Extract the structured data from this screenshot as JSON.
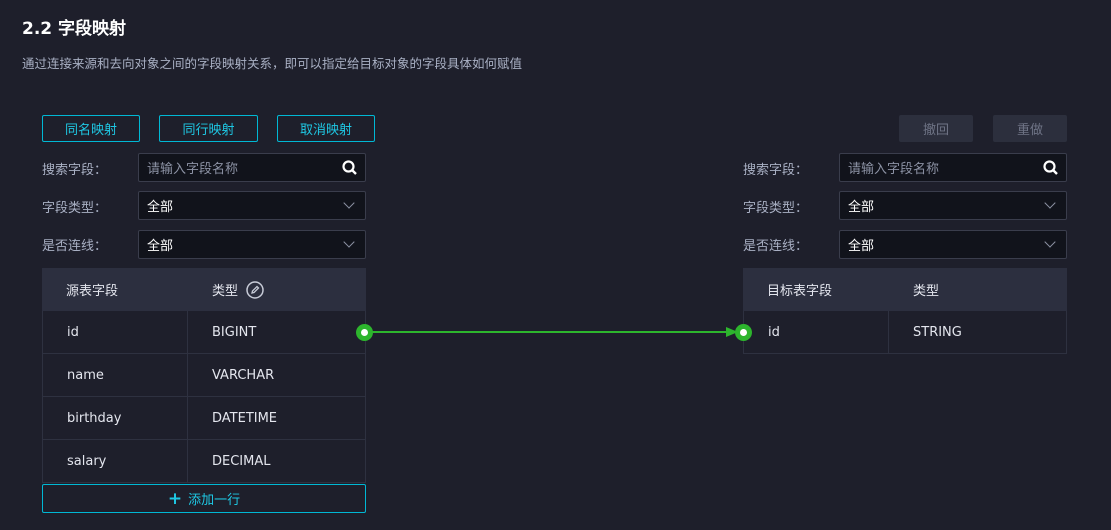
{
  "header": {
    "title": "2.2 字段映射",
    "description": "通过连接来源和去向对象之间的字段映射关系，即可以指定给目标对象的字段具体如何赋值"
  },
  "toolbar": {
    "same_name": "同名映射",
    "same_row": "同行映射",
    "cancel": "取消映射",
    "undo": "撤回",
    "redo": "重做"
  },
  "filters": {
    "search_label": "搜索字段：",
    "search_placeholder": "请输入字段名称",
    "type_label": "字段类型：",
    "type_value": "全部",
    "linked_label": "是否连线：",
    "linked_value": "全部"
  },
  "source": {
    "headers": [
      "源表字段",
      "类型"
    ],
    "rows": [
      {
        "name": "id",
        "type": "BIGINT"
      },
      {
        "name": "name",
        "type": "VARCHAR"
      },
      {
        "name": "birthday",
        "type": "DATETIME"
      },
      {
        "name": "salary",
        "type": "DECIMAL"
      }
    ],
    "add_row": "添加一行"
  },
  "target": {
    "headers": [
      "目标表字段",
      "类型"
    ],
    "rows": [
      {
        "name": "id",
        "type": "STRING"
      }
    ]
  },
  "colors": {
    "accent": "#00b8d4",
    "link": "#2db52d"
  }
}
